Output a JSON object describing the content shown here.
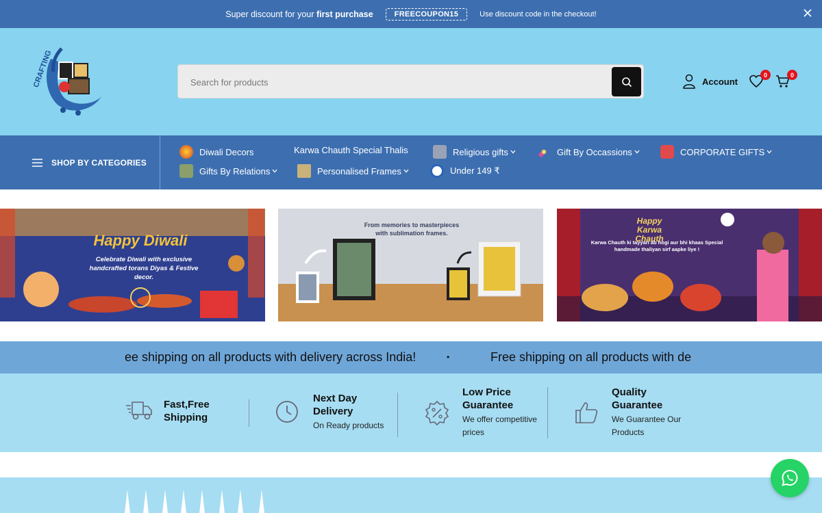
{
  "announcement": {
    "message_prefix": "Super discount for your",
    "message_bold": "first purchase",
    "coupon": "FREECOUPON15",
    "note": "Use discount code in the checkout!"
  },
  "header": {
    "search_placeholder": "Search for products",
    "account_label": "Account",
    "wishlist_count": "0",
    "cart_count": "0"
  },
  "nav": {
    "categories_label": "SHOP BY CATEGORIES",
    "items": [
      {
        "label": "Diwali Decors"
      },
      {
        "label": "Karwa Chauth Special Thalis"
      },
      {
        "label": "Religious gifts"
      },
      {
        "label": "Gift By Occassions"
      },
      {
        "label": "CORPORATE GIFTS"
      },
      {
        "label": "Gifts By Relations"
      },
      {
        "label": "Personalised Frames"
      },
      {
        "label": "Under 149 ₹"
      }
    ]
  },
  "banners": [
    {
      "heading": "Happy Diwali",
      "text": "Celebrate Diwali with exclusive handcrafted torans Diyas & Festive decor."
    },
    {
      "heading": "From memories to masterpieces",
      "text": "with sublimation frames."
    },
    {
      "heading": "Happy Karwa Chauth",
      "text": "Karwa Chauth ki tayyari ab hogi aur bhi khaas Special handmade thaliyan sirf aapke liye !"
    }
  ],
  "marquee": {
    "text_a": "ee shipping on all products with delivery across India!",
    "separator": "•",
    "text_b": "Free shipping on all products with de"
  },
  "features": [
    {
      "title_1": "Fast,Free",
      "title_2": "Shipping",
      "subtitle_1": "",
      "subtitle_2": ""
    },
    {
      "title_1": "Next Day",
      "title_2": "Delivery",
      "subtitle_1": "On Ready products",
      "subtitle_2": ""
    },
    {
      "title_1": "Low Price",
      "title_2": "Guarantee",
      "subtitle_1": "We offer competitive",
      "subtitle_2": "prices"
    },
    {
      "title_1": "Quality",
      "title_2": "Guarantee",
      "subtitle_1": "We Guarantee Our",
      "subtitle_2": "Products"
    }
  ],
  "colors": {
    "topbar": "#3d6fb0",
    "header": "#87d3f0",
    "features": "#a6ddf2",
    "badge": "#e3141c",
    "whatsapp": "#25d366"
  }
}
